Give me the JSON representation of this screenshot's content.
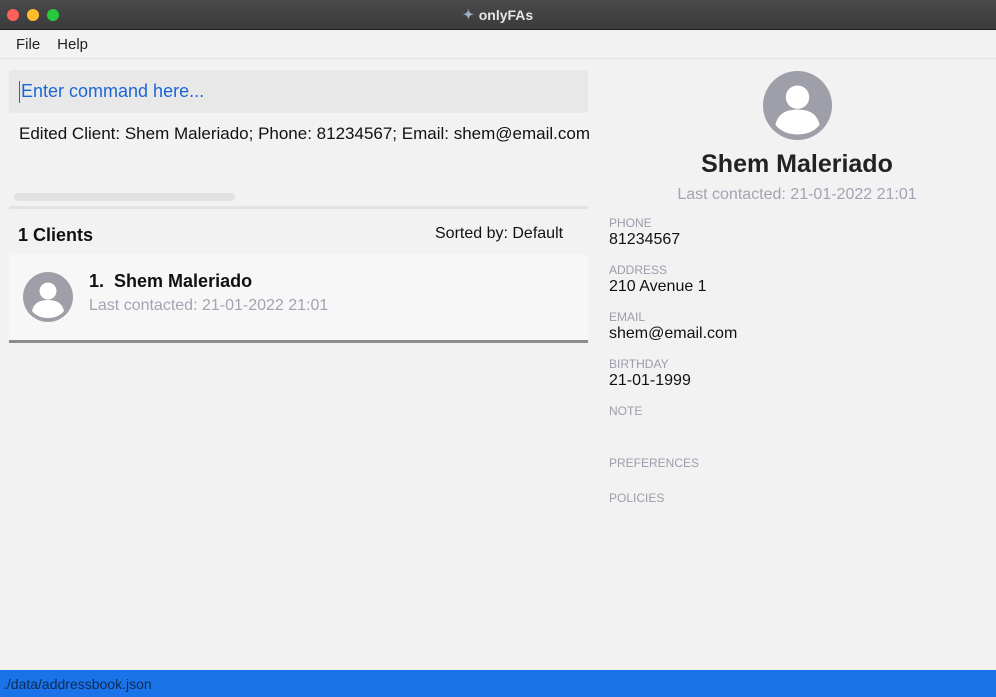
{
  "window": {
    "title": "onlyFAs",
    "app_icon": "app-logo-icon"
  },
  "menu": {
    "file": "File",
    "help": "Help"
  },
  "command": {
    "placeholder": "Enter command here..."
  },
  "result": {
    "message": "Edited Client: Shem Maleriado; Phone: 81234567; Email: shem@email.com;"
  },
  "list": {
    "count_label": "1 Clients",
    "sort_label": "Sorted by: Default",
    "clients": [
      {
        "index": "1.",
        "name": "Shem Maleriado",
        "last_contacted": "Last contacted: 21-01-2022 21:01"
      }
    ]
  },
  "detail": {
    "name": "Shem Maleriado",
    "last_contacted": "Last contacted: 21-01-2022 21:01",
    "phone_label": "PHONE",
    "phone": "81234567",
    "address_label": "ADDRESS",
    "address": "210 Avenue 1",
    "email_label": "EMAIL",
    "email": "shem@email.com",
    "birthday_label": "BIRTHDAY",
    "birthday": "21-01-1999",
    "note_label": "NOTE",
    "preferences_label": "PREFERENCES",
    "policies_label": "POLICIES"
  },
  "status": {
    "path": "./data/addressbook.json"
  },
  "colors": {
    "accent": "#1a73e8",
    "command_text": "#1b66d6",
    "muted": "#a3a3b3"
  }
}
